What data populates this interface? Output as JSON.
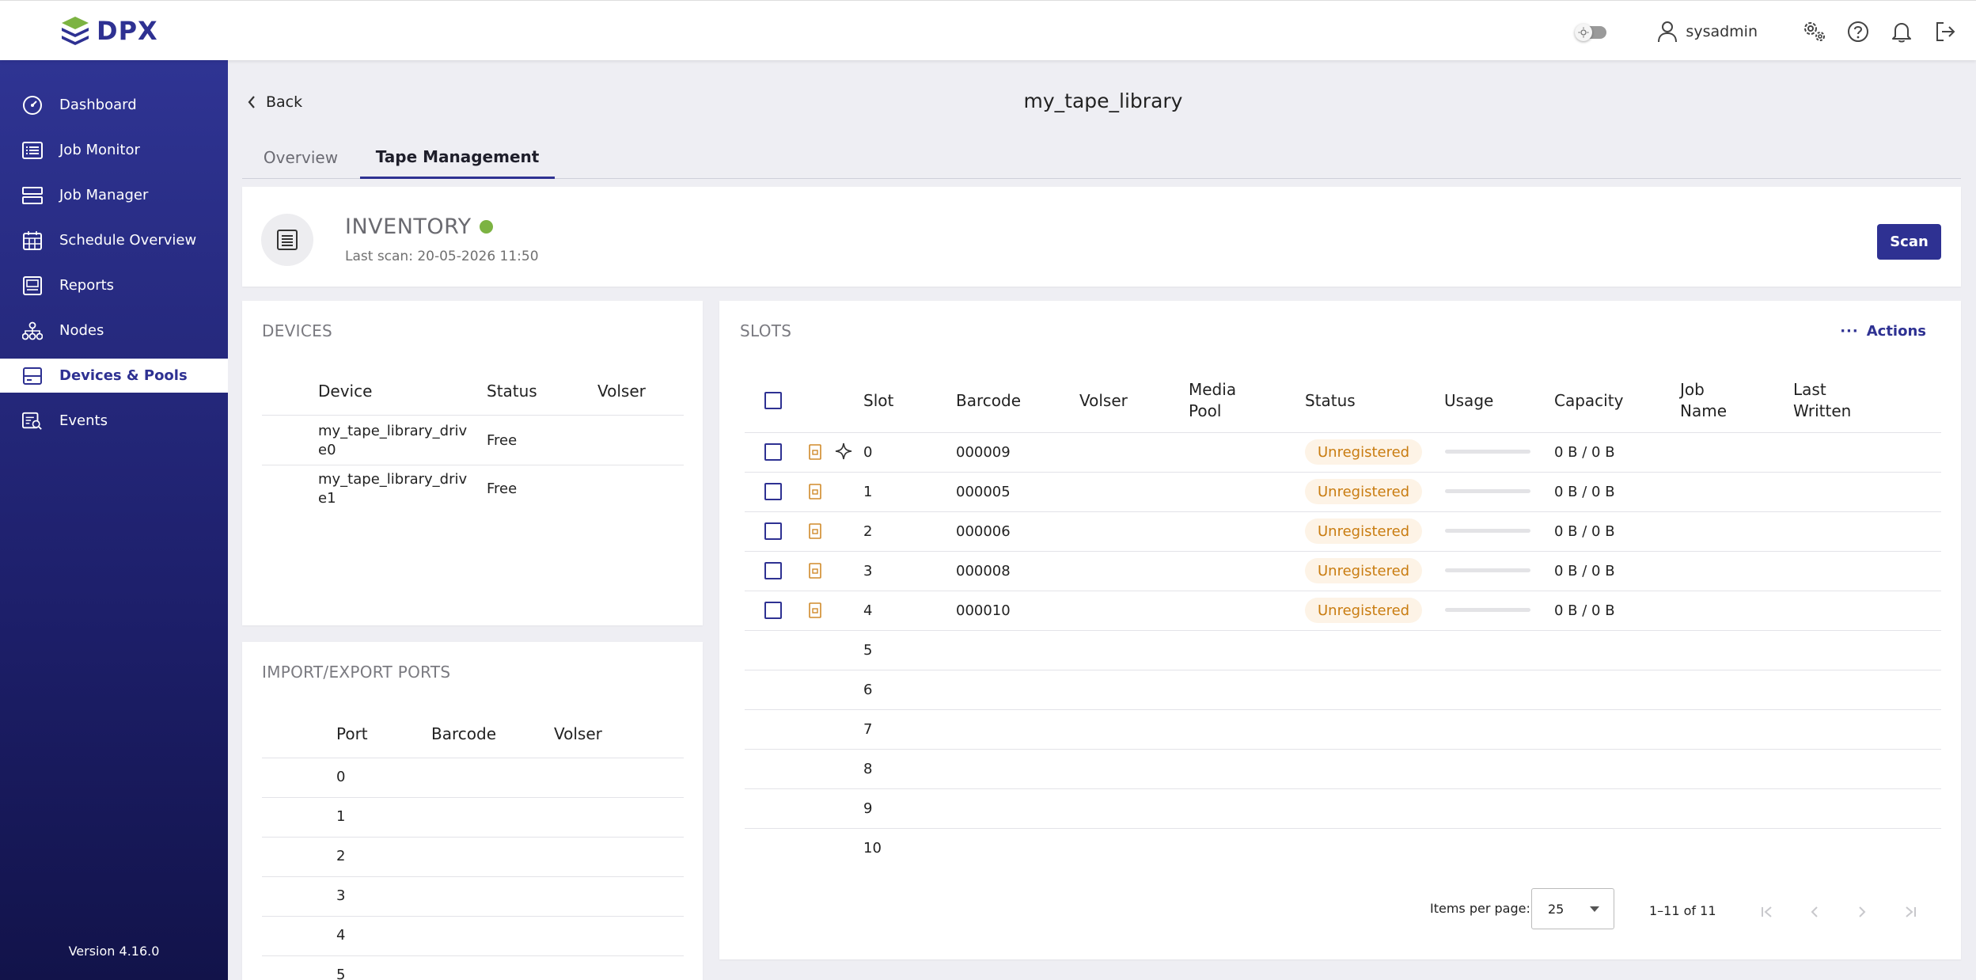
{
  "header": {
    "brand": "DPX",
    "user": "sysadmin"
  },
  "sidebar": {
    "items": [
      {
        "label": "Dashboard",
        "icon": "dashboard-icon"
      },
      {
        "label": "Job Monitor",
        "icon": "job-monitor-icon"
      },
      {
        "label": "Job Manager",
        "icon": "job-manager-icon"
      },
      {
        "label": "Schedule Overview",
        "icon": "calendar-icon"
      },
      {
        "label": "Reports",
        "icon": "reports-icon"
      },
      {
        "label": "Nodes",
        "icon": "nodes-icon"
      },
      {
        "label": "Devices & Pools",
        "icon": "devices-icon",
        "active": true
      },
      {
        "label": "Events",
        "icon": "events-icon"
      }
    ],
    "version": "Version 4.16.0"
  },
  "page": {
    "back_label": "Back",
    "title": "my_tape_library",
    "tabs": [
      {
        "label": "Overview",
        "active": false
      },
      {
        "label": "Tape Management",
        "active": true
      }
    ]
  },
  "inventory": {
    "title": "INVENTORY",
    "status_color": "#7cb342",
    "last_scan": "Last scan: 20-05-2026 11:50",
    "scan_label": "Scan"
  },
  "devices": {
    "title": "DEVICES",
    "columns": [
      "Device",
      "Status",
      "Volser"
    ],
    "rows": [
      {
        "device": "my_tape_library_drive0",
        "device_line1": "my_tape_library_driv",
        "device_line2": "e0",
        "status": "Free",
        "volser": ""
      },
      {
        "device": "my_tape_library_drive1",
        "device_line1": "my_tape_library_driv",
        "device_line2": "e1",
        "status": "Free",
        "volser": ""
      }
    ]
  },
  "ports": {
    "title": "IMPORT/EXPORT PORTS",
    "columns": [
      "Port",
      "Barcode",
      "Volser"
    ],
    "rows": [
      "0",
      "1",
      "2",
      "3",
      "4",
      "5"
    ]
  },
  "slots": {
    "title": "SLOTS",
    "actions_label": "Actions",
    "columns": {
      "slot": "Slot",
      "barcode": "Barcode",
      "volser": "Volser",
      "media_pool_1": "Media",
      "media_pool_2": "Pool",
      "status": "Status",
      "usage": "Usage",
      "capacity": "Capacity",
      "job_name_1": "Job",
      "job_name_2": "Name",
      "last_written_1": "Last",
      "last_written_2": "Written"
    },
    "rows": [
      {
        "slot": "0",
        "barcode": "000009",
        "status": "Unregistered",
        "usage": 0,
        "capacity": "0 B / 0 B",
        "has_tape": true,
        "special": true
      },
      {
        "slot": "1",
        "barcode": "000005",
        "status": "Unregistered",
        "usage": 0,
        "capacity": "0 B / 0 B",
        "has_tape": true
      },
      {
        "slot": "2",
        "barcode": "000006",
        "status": "Unregistered",
        "usage": 0,
        "capacity": "0 B / 0 B",
        "has_tape": true
      },
      {
        "slot": "3",
        "barcode": "000008",
        "status": "Unregistered",
        "usage": 0,
        "capacity": "0 B / 0 B",
        "has_tape": true
      },
      {
        "slot": "4",
        "barcode": "000010",
        "status": "Unregistered",
        "usage": 0,
        "capacity": "0 B / 0 B",
        "has_tape": true
      },
      {
        "slot": "5"
      },
      {
        "slot": "6"
      },
      {
        "slot": "7"
      },
      {
        "slot": "8"
      },
      {
        "slot": "9"
      },
      {
        "slot": "10"
      }
    ],
    "pager": {
      "items_per_page_label": "Items per page:",
      "items_per_page": "25",
      "range": "1–11 of 11"
    }
  },
  "colors": {
    "accent": "#2e3192",
    "badge_text": "#c97c10",
    "badge_bg": "#fdf3e6",
    "online": "#7cb342"
  }
}
